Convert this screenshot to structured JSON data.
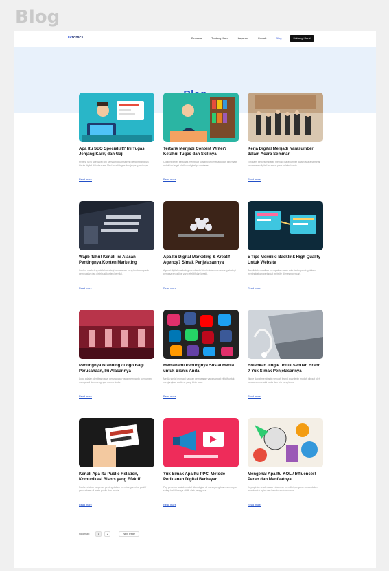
{
  "frame_label": "Blog",
  "nav": {
    "logo_mark": "TP",
    "logo_text": "tonics",
    "menu": [
      "Beranda",
      "Tentang Kami",
      "Layanan",
      "Kontak",
      "Blog"
    ],
    "cta": "Hubungi Kami"
  },
  "hero": {
    "title": "Blog"
  },
  "posts": [
    {
      "title": "Apa Itu SEO Specialist? Ini Tugas, Jenjang Karir, dan Gaji",
      "excerpt": "Profesi SEO specialist kini semakin dicari seiring berkembangnya bisnis digital di Indonesia. Mari kenali tugas dan jenjang karirnya.",
      "link": "Read more",
      "image": "seo-specialist-illustration"
    },
    {
      "title": "Tertarik Menjadi Content Writer? Ketahui Tugas dan Skillnya",
      "excerpt": "Content writer bertugas membuat tulisan yang menarik dan informatif untuk berbagai platform digital perusahaan.",
      "link": "Read more",
      "image": "content-writer-illustration"
    },
    {
      "title": "Kerja Digital Menjadi Narasumber dalam Acara Seminar",
      "excerpt": "Tim kami berkesempatan menjadi narasumber dalam acara seminar pemasaran digital bersama para pelaku bisnis.",
      "link": "Read more",
      "image": "seminar-photo"
    },
    {
      "title": "Wajib Tahu! Kenali Ini Alasan Pentingnya Konten Marketing",
      "excerpt": "Konten marketing adalah strategi pemasaran yang berfokus pada pembuatan dan distribusi konten bernilai.",
      "link": "Read more",
      "image": "laptop-keyboard-photo"
    },
    {
      "title": "Apa Itu Digital Marketing & Kreatif Agency? Simak Penjelasannya",
      "excerpt": "Agensi digital marketing membantu bisnis dalam merancang strategi pemasaran online yang efektif dan kreatif.",
      "link": "Read more",
      "image": "digital-agency-photo"
    },
    {
      "title": "5 Tips Memiliki Backlink High Quality Untuk Website",
      "excerpt": "Backlink berkualitas merupakan salah satu faktor penting dalam meningkatkan peringkat website di mesin pencari.",
      "link": "Read more",
      "image": "backlink-illustration"
    },
    {
      "title": "Pentingnya Branding / Logo Bagi Perusahaan, Ini Alasannya",
      "excerpt": "Logo adalah identitas visual perusahaan yang membantu konsumen mengenali dan mengingat merek Anda.",
      "link": "Read more",
      "image": "branding-photo"
    },
    {
      "title": "Memahami Pentingnya Sosial Media untuk Bisnis Anda",
      "excerpt": "Media sosial menjadi saluran pemasaran yang sangat efektif untuk menjangkau audiens yang lebih luas.",
      "link": "Read more",
      "image": "social-media-apps-photo"
    },
    {
      "title": "Bolehkah Jingle untuk Sebuah Brand ? Yuk Simak Penjelasannya",
      "excerpt": "Jingle dapat membantu sebuah brand agar lebih mudah diingat oleh konsumen melalui nada dan lirik yang khas.",
      "link": "Read more",
      "image": "earphones-laptop-photo"
    },
    {
      "title": "Kenali Apa Itu Public Relation, Komunikasi Bisnis yang Efektif",
      "excerpt": "Public relation berperan penting dalam membangun citra positif perusahaan di mata publik dan media.",
      "link": "Read more",
      "image": "public-relations-photo"
    },
    {
      "title": "Yuk Simak Apa Itu PPC, Metode Periklanan Digital Berbayar",
      "excerpt": "Pay per click adalah model iklan digital di mana pengiklan membayar setiap kali iklannya diklik oleh pengguna.",
      "link": "Read more",
      "image": "ppc-megaphone-illustration"
    },
    {
      "title": "Mengenal Apa Itu KOL / Influencer! Peran dan Manfaatnya",
      "excerpt": "Key opinion leader atau influencer memiliki pengaruh besar dalam membentuk opini dan keputusan konsumen.",
      "link": "Read more",
      "image": "influencer-collage"
    }
  ],
  "pagination": {
    "label": "Halaman:",
    "pages": [
      "1",
      "2"
    ],
    "next": "Next Page"
  }
}
